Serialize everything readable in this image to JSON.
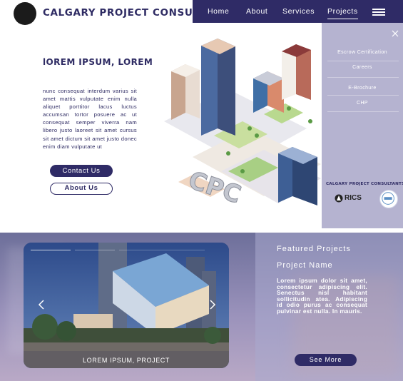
{
  "header": {
    "brand": "CALGARY PROJECT CONSULTANTS",
    "nav": [
      "Home",
      "About",
      "Services",
      "Projects"
    ],
    "active_nav": "Projects"
  },
  "hero": {
    "title": "lOREM IPSUM, LOREM",
    "body": "nunc consequat interdum varius sit amet mattis vulputate enim nulla aliquet porttitor lacus luctus accumsan tortor posuere ac ut consequat semper viverra nam libero justo laoreet sit amet cursus sit amet dictum sit amet justo donec enim diam vulputate ut",
    "contact_label": "Contact Us",
    "about_label": "About Us",
    "illustration_lettering": "CPC"
  },
  "menu": {
    "items": [
      "Escrow Certification",
      "Careers",
      "E-Brochure",
      "CHP"
    ],
    "brand": "CALGARY PROJECT CONSULTANTS",
    "logo_text": "RICS"
  },
  "featured": {
    "heading": "Featured Projects",
    "project_name": "Project Name",
    "description": "Lorem ipsum dolor sit amet, consectetur adipiscing elit. Senectus nisl habitant sollicitudin atea. Adipiscing id odio purus ac consequat pulvinar est nulla. In mauris.",
    "see_more_label": "See More",
    "slide_caption": "LOREM IPSUM, PROJECT",
    "slide_count": 3,
    "current_slide": 1
  },
  "colors": {
    "brand_navy": "#2f2b66",
    "menu_overlay": "#a09ec3",
    "white": "#ffffff"
  },
  "icons": [
    "logo-circle-icon",
    "hamburger-icon",
    "close-icon",
    "chevron-left-icon",
    "chevron-right-icon",
    "rics-logo-icon",
    "badge-logo-icon"
  ]
}
